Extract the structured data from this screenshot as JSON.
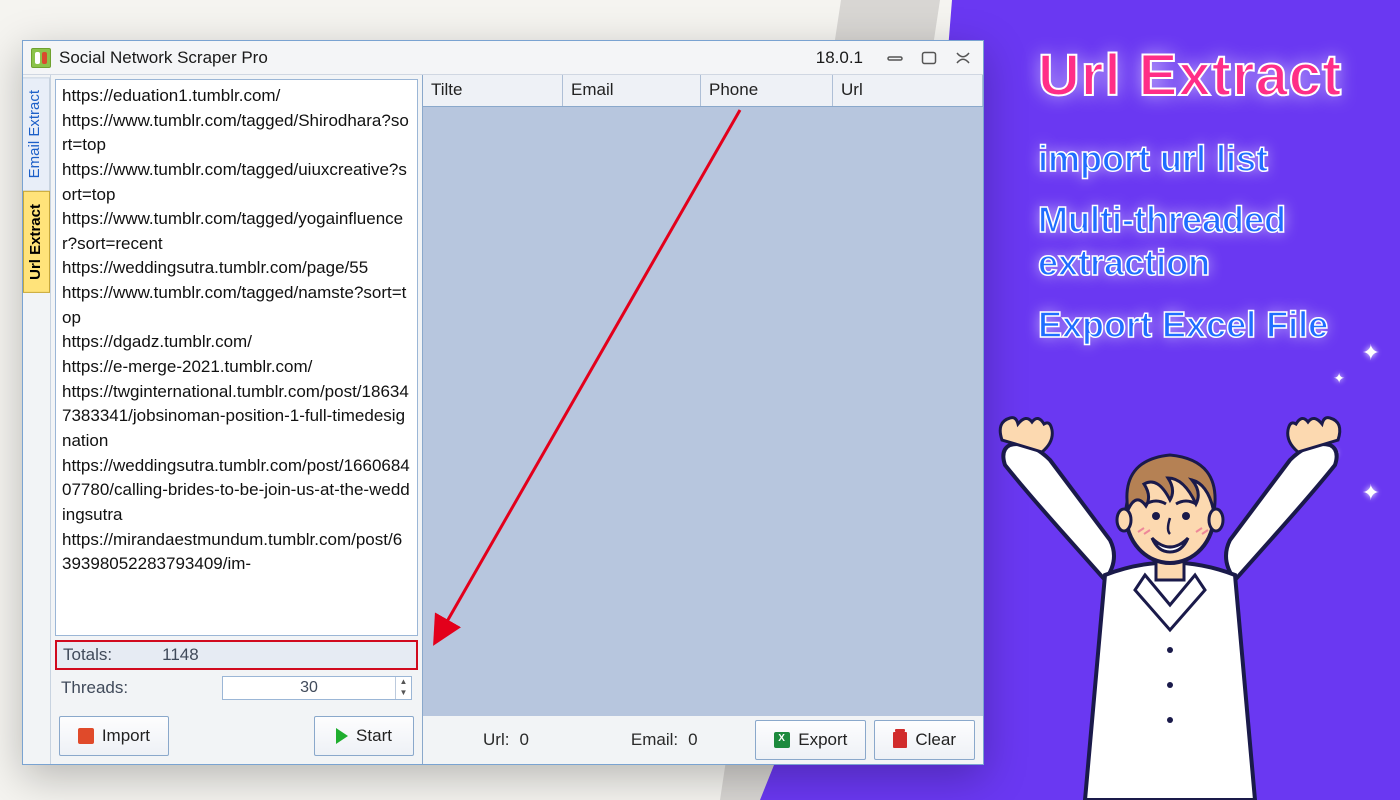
{
  "window": {
    "title": "Social Network Scraper Pro",
    "version": "18.0.1"
  },
  "tabs": {
    "email_extract": "Email Extract",
    "url_extract": "Url Extract"
  },
  "url_list": [
    "https://eduation1.tumblr.com/",
    "https://www.tumblr.com/tagged/Shirodhara?sort=top",
    "https://www.tumblr.com/tagged/uiuxcreative?sort=top",
    "https://www.tumblr.com/tagged/yogainfluencer?sort=recent",
    "https://weddingsutra.tumblr.com/page/55",
    "https://www.tumblr.com/tagged/namste?sort=top",
    "https://dgadz.tumblr.com/",
    "https://e-merge-2021.tumblr.com/",
    "https://twginternational.tumblr.com/post/186347383341/jobsinoman-position-1-full-timedesignation",
    "https://weddingsutra.tumblr.com/post/166068407780/calling-brides-to-be-join-us-at-the-weddingsutra",
    "https://mirandaestmundum.tumblr.com/post/639398052283793409/im-"
  ],
  "totals": {
    "label": "Totals:",
    "value": "1148"
  },
  "threads": {
    "label": "Threads:",
    "value": "30"
  },
  "buttons": {
    "import": "Import",
    "start": "Start",
    "export": "Export",
    "clear": "Clear"
  },
  "grid_columns": {
    "title": "Tilte",
    "email": "Email",
    "phone": "Phone",
    "url": "Url"
  },
  "status": {
    "url_label": "Url:",
    "url_value": "0",
    "email_label": "Email:",
    "email_value": "0"
  },
  "promo": {
    "heading": "Url Extract",
    "line1": "import url list",
    "line2": "Multi-threaded extraction",
    "line3": "Export Excel File"
  }
}
